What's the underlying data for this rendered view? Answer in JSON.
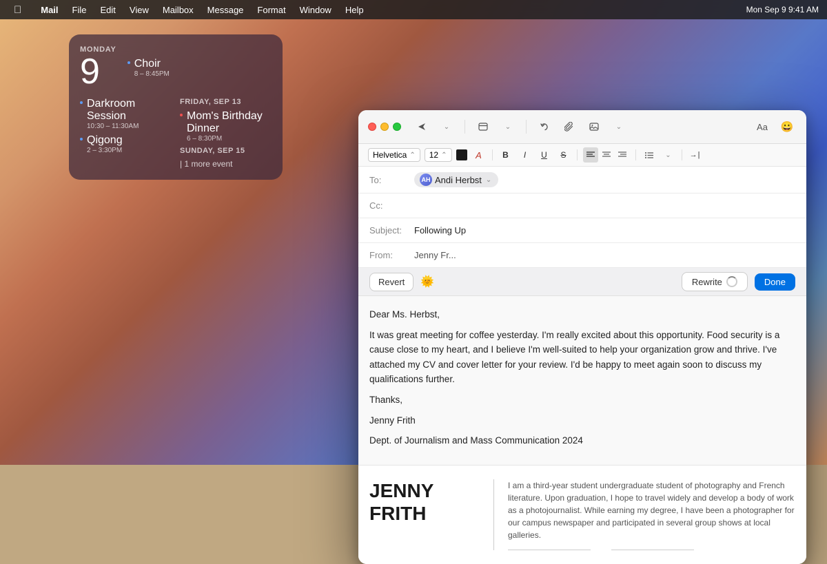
{
  "desktop": {
    "bg": "gradient"
  },
  "menubar": {
    "apple": "&#63743;",
    "app": "Mail",
    "items": [
      "File",
      "Edit",
      "View",
      "Mailbox",
      "Message",
      "Format",
      "Window",
      "Help"
    ]
  },
  "calendar": {
    "day_label": "MONDAY",
    "day_num": "9",
    "monday_events": [
      {
        "name": "Choir",
        "time": "8 – 8:45PM",
        "color": "dot-blue"
      }
    ],
    "friday_label": "FRIDAY, SEP 13",
    "friday_events": [
      {
        "name": "Mom's Birthday Dinner",
        "time": "6 – 8:30PM",
        "color": "dot-red"
      }
    ],
    "left_events": [
      {
        "name": "Darkroom Session",
        "time": "10:30 – 11:30AM"
      },
      {
        "name": "Qigong",
        "time": "2 – 3:30PM"
      }
    ],
    "sunday_label": "SUNDAY, SEP 15",
    "more_events": "1 more event"
  },
  "mail": {
    "toolbar": {
      "send_label": "&#10148;",
      "chevron_label": "&#8964;",
      "text_format": "Aa",
      "emoji_label": "&#128512;",
      "undo_label": "&#8617;",
      "attach_label": "&#128206;",
      "compose_label": "&#9634;"
    },
    "format_bar": {
      "font": "Helvetica",
      "size": "12",
      "bold": "B",
      "italic": "I",
      "underline": "U",
      "strikethrough": "S"
    },
    "to_label": "To:",
    "to_recipient": "Andi Herbst",
    "to_recipient_initials": "AH",
    "cc_label": "Cc:",
    "subject_label": "Subject:",
    "subject_value": "Following Up",
    "from_label": "From:",
    "from_value": "Jenny Fr...",
    "ai_revert": "Revert",
    "ai_rewrite": "Rewrite",
    "ai_done": "Done",
    "body_salutation": "Dear Ms. Herbst,",
    "body_p1": "It was great meeting for coffee yesterday. I'm really excited about this opportunity. Food security is a cause close to my heart, and I believe I'm well-suited to help your organization grow and thrive. I've attached my CV and cover letter for your review. I'd be happy to meet again soon to discuss my qualifications further.",
    "body_closing": "Thanks,",
    "body_name": "Jenny Frith",
    "body_dept": "Dept. of Journalism and Mass Communication 2024",
    "sig_name_line1": "JENNY",
    "sig_name_line2": "FRITH",
    "sig_bio": "I am a third-year student undergraduate student of photography and French literature. Upon graduation, I hope to travel widely and develop a body of work as a photojournalist. While earning my degree, I have been a photographer for our campus newspaper and participated in several group shows at local galleries."
  }
}
